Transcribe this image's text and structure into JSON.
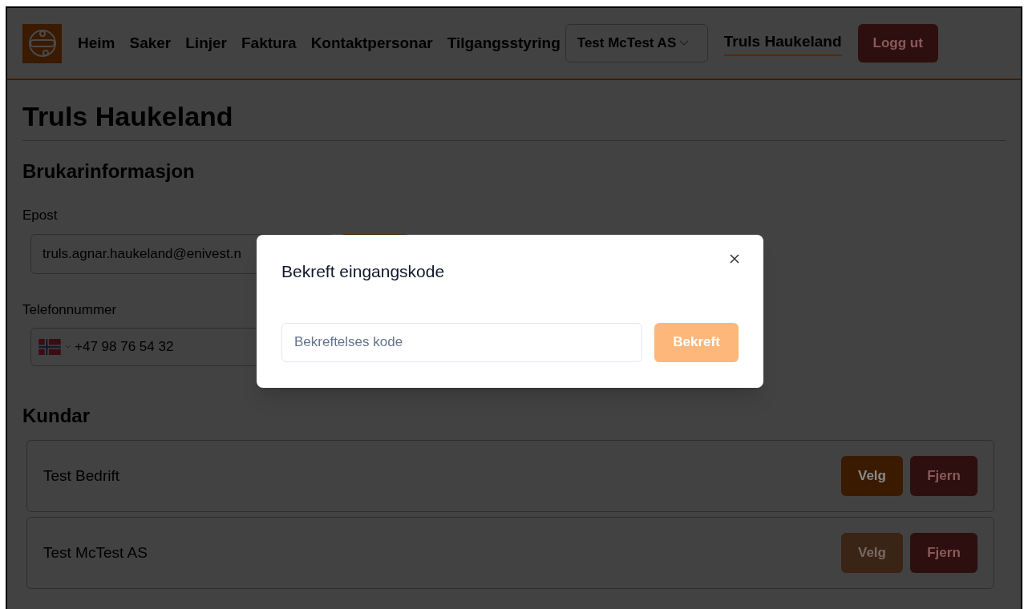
{
  "nav": {
    "links": [
      {
        "label": "Heim"
      },
      {
        "label": "Saker"
      },
      {
        "label": "Linjer"
      },
      {
        "label": "Faktura"
      },
      {
        "label": "Kontaktpersonar"
      },
      {
        "label": "Tilgangsstyring"
      }
    ],
    "company_select": {
      "value": "Test McTest AS"
    },
    "user_link": {
      "label": "Truls Haukeland",
      "selected": true
    },
    "logout_button": {
      "label": "Logg ut"
    }
  },
  "page_title": "Truls Haukeland",
  "user_info": {
    "heading": "Brukarinformasjon",
    "email": {
      "label": "Epost",
      "value": "truls.agnar.haukeland@enivest.n"
    },
    "phone": {
      "label": "Telefonnummer",
      "value": "+47 98 76 54 32"
    }
  },
  "customers": {
    "heading": "Kundar",
    "items": [
      {
        "name": "Test Bedrift",
        "select_label": "Velg",
        "select_disabled": false,
        "remove_label": "Fjern"
      },
      {
        "name": "Test McTest AS",
        "select_label": "Velg",
        "select_disabled": true,
        "remove_label": "Fjern"
      }
    ]
  },
  "modal": {
    "title": "Bekreft eingangskode",
    "code_field": {
      "placeholder": "Bekreftelses kode"
    },
    "confirm_button": {
      "label": "Bekreft"
    }
  }
}
